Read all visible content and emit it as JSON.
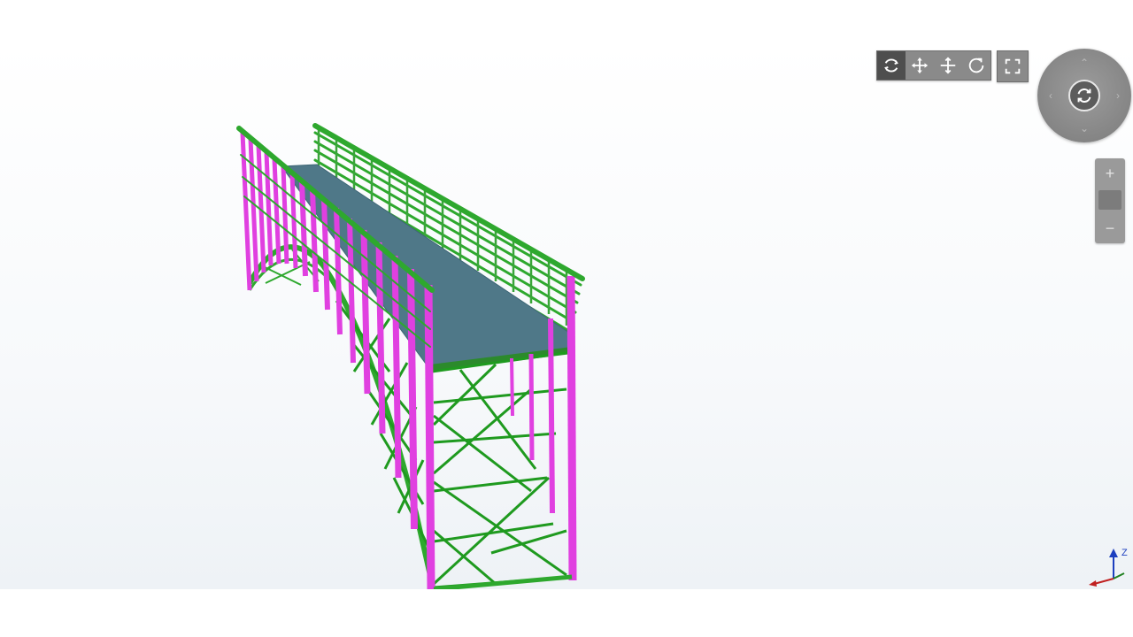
{
  "viewer": {
    "toolbar": {
      "buttons": [
        {
          "name": "orbit",
          "icon": "orbit-icon",
          "active": true
        },
        {
          "name": "pan",
          "icon": "pan-icon",
          "active": false
        },
        {
          "name": "move",
          "icon": "move-icon",
          "active": false
        },
        {
          "name": "rotate",
          "icon": "rotate-icon",
          "active": false
        }
      ],
      "fullscreen_icon": "fullscreen-icon"
    },
    "viewcube": {
      "center_icon": "rotate-view-icon",
      "arrows": [
        "up",
        "down",
        "left",
        "right"
      ]
    },
    "zoom_control": {
      "plus_icon": "zoom-in-icon",
      "minus_icon": "zoom-out-icon"
    },
    "axis_triad": {
      "label": "Z"
    }
  },
  "model": {
    "type": "3D truss bridge structural model",
    "colors": {
      "columns": "#e040e0",
      "beams": "#2ea82e",
      "bracing": "#1f9a1f",
      "deck": "#4f7888",
      "background": "#f4f7fa"
    }
  }
}
